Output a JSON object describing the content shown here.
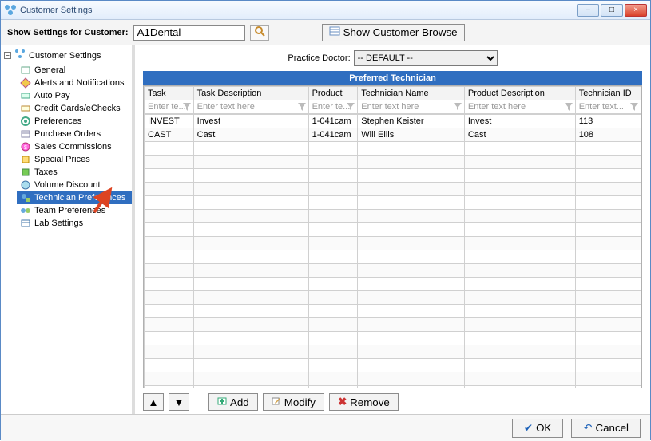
{
  "window": {
    "title": "Customer Settings",
    "minimize": "–",
    "maximize": "□",
    "close": "×"
  },
  "toolbar": {
    "label": "Show Settings for Customer:",
    "customer_value": "A1Dental",
    "browse_label": "Show Customer Browse"
  },
  "sidebar": {
    "root_label": "Customer Settings",
    "items": [
      {
        "label": "General"
      },
      {
        "label": "Alerts and Notifications"
      },
      {
        "label": "Auto Pay"
      },
      {
        "label": "Credit Cards/eChecks"
      },
      {
        "label": "Preferences"
      },
      {
        "label": "Purchase Orders"
      },
      {
        "label": "Sales Commissions"
      },
      {
        "label": "Special Prices"
      },
      {
        "label": "Taxes"
      },
      {
        "label": "Volume Discount"
      },
      {
        "label": "Technician Preferences"
      },
      {
        "label": "Team Preferences"
      },
      {
        "label": "Lab Settings"
      }
    ],
    "selected_index": 10
  },
  "content": {
    "doctor_label": "Practice Doctor:",
    "doctor_value": "-- DEFAULT --",
    "panel_title": "Preferred Technician",
    "columns": [
      "Task",
      "Task Description",
      "Product",
      "Technician Name",
      "Product Description",
      "Technician ID"
    ],
    "filter_placeholders": [
      "Enter te...",
      "Enter text here",
      "Enter te...",
      "Enter text here",
      "Enter text here",
      "Enter text..."
    ],
    "rows": [
      {
        "task": "INVEST",
        "task_desc": "Invest",
        "product": "1-041cam",
        "tech_name": "Stephen Keister",
        "prod_desc": "Invest",
        "tech_id": "113"
      },
      {
        "task": "CAST",
        "task_desc": "Cast",
        "product": "1-041cam",
        "tech_name": "Will Ellis",
        "prod_desc": "Cast",
        "tech_id": "108"
      }
    ],
    "buttons": {
      "up": "▲",
      "down": "▼",
      "add": "Add",
      "modify": "Modify",
      "remove": "Remove"
    }
  },
  "footer": {
    "ok": "OK",
    "cancel": "Cancel"
  },
  "icons": {
    "check": "✔",
    "x": "✖",
    "undo": "↶"
  },
  "colors": {
    "accent": "#2f6ec0"
  }
}
